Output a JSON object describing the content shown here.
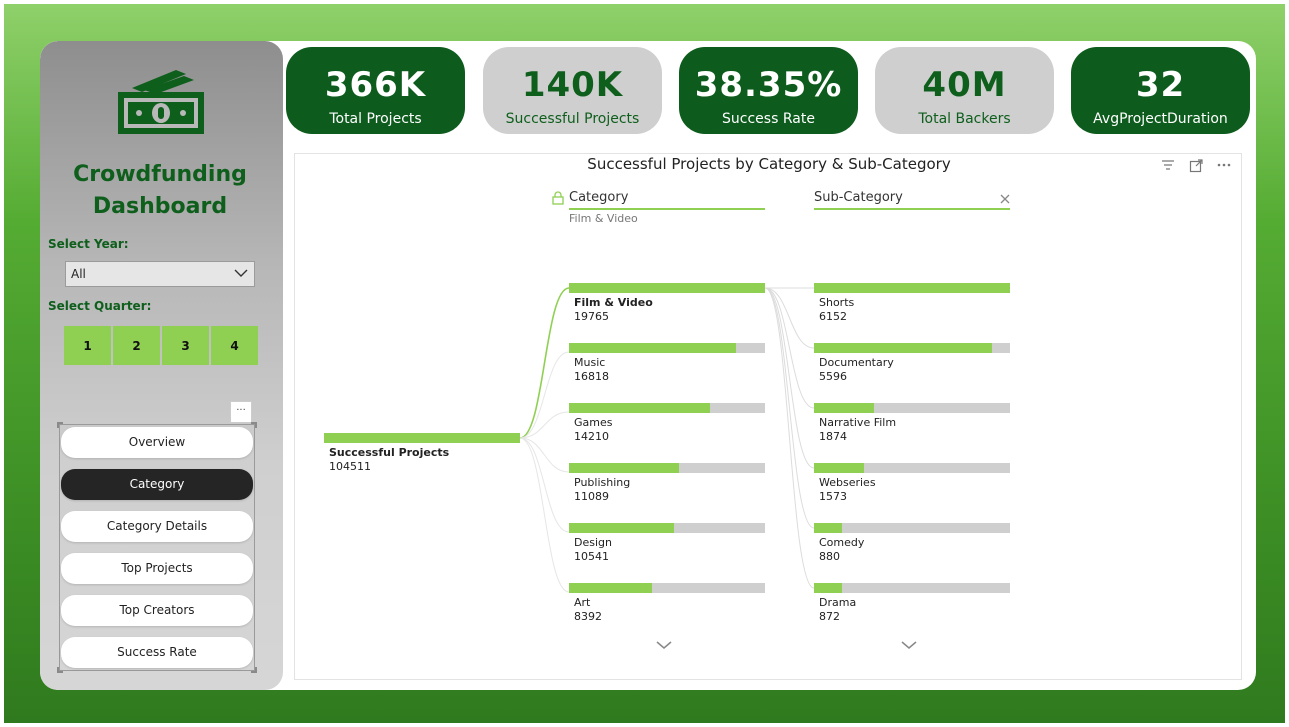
{
  "sidebar": {
    "title_line1": "Crowdfunding",
    "title_line2": "Dashboard",
    "year_label": "Select Year:",
    "year_value": "All",
    "quarter_label": "Select Quarter:",
    "quarters": [
      "1",
      "2",
      "3",
      "4"
    ],
    "more_label": "···",
    "nav": [
      "Overview",
      "Category",
      "Category Details",
      "Top Projects",
      "Top Creators",
      "Success Rate"
    ],
    "active_nav": "Category"
  },
  "kpis": [
    {
      "value": "366K",
      "label": "Total Projects",
      "style": "dark"
    },
    {
      "value": "140K",
      "label": "Successful Projects",
      "style": "light"
    },
    {
      "value": "38.35%",
      "label": "Success Rate",
      "style": "dark"
    },
    {
      "value": "40M",
      "label": "Total Backers",
      "style": "light"
    },
    {
      "value": "32",
      "label": "AvgProjectDuration",
      "style": "dark"
    }
  ],
  "visual": {
    "title": "Successful Projects by Category & Sub-Category",
    "category_header": "Category",
    "category_selected": "Film & Video",
    "subcategory_header": "Sub-Category",
    "root_label": "Successful Projects",
    "root_value": "104511",
    "categories": [
      {
        "name": "Film & Video",
        "value": 19765,
        "value_text": "19765",
        "selected": true
      },
      {
        "name": "Music",
        "value": 16818,
        "value_text": "16818"
      },
      {
        "name": "Games",
        "value": 14210,
        "value_text": "14210"
      },
      {
        "name": "Publishing",
        "value": 11089,
        "value_text": "11089"
      },
      {
        "name": "Design",
        "value": 10541,
        "value_text": "10541"
      },
      {
        "name": "Art",
        "value": 8392,
        "value_text": "8392"
      }
    ],
    "subcategories": [
      {
        "name": "Shorts",
        "value": 6152,
        "value_text": "6152"
      },
      {
        "name": "Documentary",
        "value": 5596,
        "value_text": "5596"
      },
      {
        "name": "Narrative Film",
        "value": 1874,
        "value_text": "1874"
      },
      {
        "name": "Webseries",
        "value": 1573,
        "value_text": "1573"
      },
      {
        "name": "Comedy",
        "value": 880,
        "value_text": "880"
      },
      {
        "name": "Drama",
        "value": 872,
        "value_text": "872"
      }
    ]
  },
  "colors": {
    "accent_green": "#8fd053",
    "dark_green": "#0d5c1d",
    "track_gray": "#cfcfcf"
  }
}
